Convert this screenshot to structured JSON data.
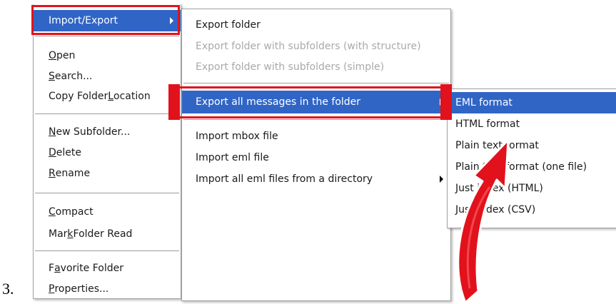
{
  "step_number": "3.",
  "menu_main": {
    "items": [
      {
        "label": "Import/Export",
        "has_submenu": true,
        "highlighted": true
      },
      {
        "label_pre": "",
        "label_u": "O",
        "label_post": "pen"
      },
      {
        "label_pre": "",
        "label_u": "S",
        "label_post": "earch..."
      },
      {
        "label_pre": "Copy Folder ",
        "label_u": "L",
        "label_post": "ocation"
      },
      {
        "label_pre": "",
        "label_u": "N",
        "label_post": "ew Subfolder..."
      },
      {
        "label_pre": "",
        "label_u": "D",
        "label_post": "elete"
      },
      {
        "label_pre": "",
        "label_u": "R",
        "label_post": "ename"
      },
      {
        "label_pre": "",
        "label_u": "C",
        "label_post": "ompact"
      },
      {
        "label_pre": "Mar",
        "label_u": "k",
        "label_post": " Folder Read"
      },
      {
        "label_pre": "F",
        "label_u": "a",
        "label_post": "vorite Folder"
      },
      {
        "label_pre": "",
        "label_u": "P",
        "label_post": "roperties..."
      }
    ]
  },
  "menu_import_export": {
    "items": [
      {
        "label": "Export folder",
        "disabled": false
      },
      {
        "label": "Export folder with subfolders (with structure)",
        "disabled": true
      },
      {
        "label": "Export folder with subfolders (simple)",
        "disabled": true
      },
      {
        "label": "Export all messages in the folder",
        "has_submenu": true,
        "highlighted": true
      },
      {
        "label": "Import mbox file"
      },
      {
        "label": "Import eml file"
      },
      {
        "label": "Import all eml files from a directory",
        "has_submenu": true
      }
    ]
  },
  "menu_export_format": {
    "items": [
      {
        "label": "EML format",
        "highlighted": true
      },
      {
        "label": "HTML format"
      },
      {
        "label": "Plain text format"
      },
      {
        "label": "Plain text format (one file)"
      },
      {
        "label": "Just index (HTML)"
      },
      {
        "label": "Just index (CSV)"
      }
    ]
  },
  "colors": {
    "highlight": "#3065c6",
    "annotation_red": "#e1121c",
    "disabled_text": "#a9a9a9"
  },
  "icons": [
    "submenu-arrow-icon",
    "red-curved-arrow"
  ]
}
